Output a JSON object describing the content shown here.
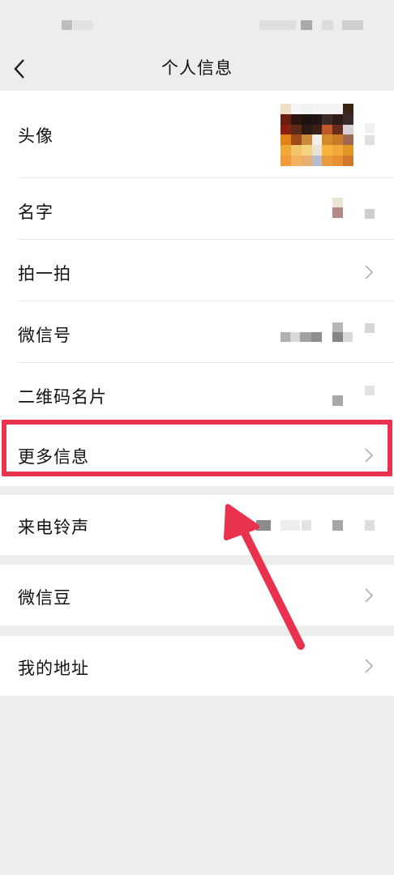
{
  "nav": {
    "title": "个人信息"
  },
  "rows": {
    "avatar_label": "头像",
    "name_label": "名字",
    "pat_label": "拍一拍",
    "wechat_id_label": "微信号",
    "qr_label": "二维码名片",
    "more_info_label": "更多信息",
    "ringtone_label": "来电铃声",
    "beans_label": "微信豆",
    "address_label": "我的地址"
  },
  "colors": {
    "highlight": "#e8324e",
    "background": "#ededed",
    "card": "#ffffff"
  },
  "icons": {
    "back": "chevron-left-icon",
    "row_arrow": "chevron-right-icon"
  }
}
